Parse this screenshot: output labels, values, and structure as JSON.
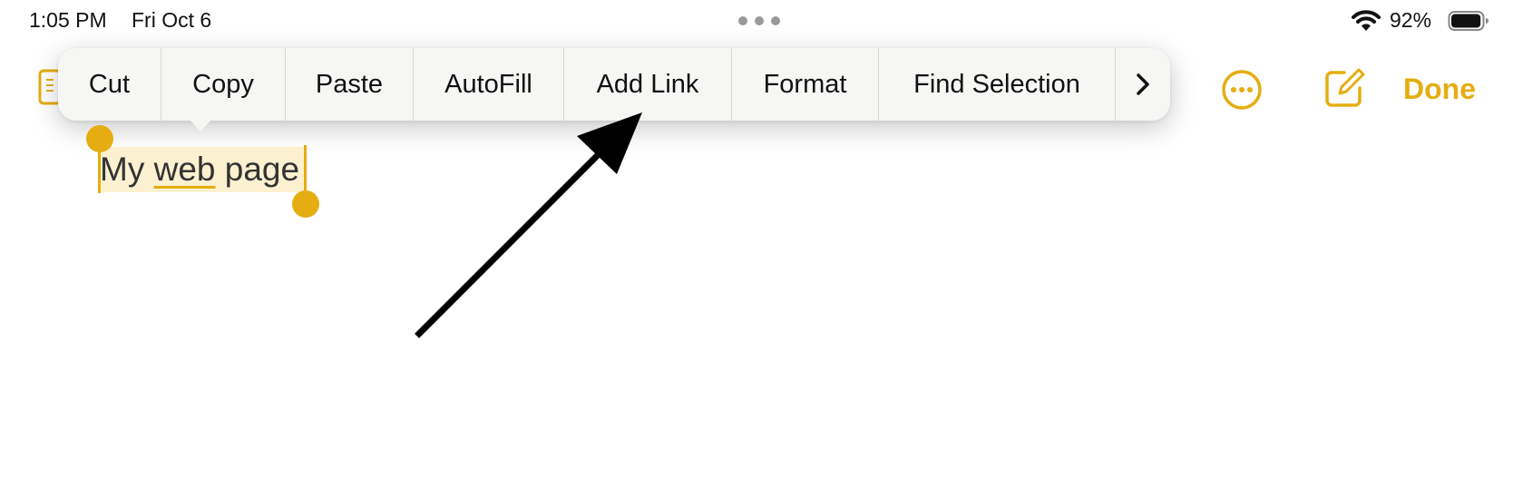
{
  "status_bar": {
    "time": "1:05 PM",
    "date": "Fri Oct 6",
    "battery_percent": "92%",
    "battery_level": 0.92,
    "icons": [
      "multitask-dots-icon",
      "wifi-icon",
      "battery-icon"
    ]
  },
  "toolbar": {
    "icons": [
      "more-icon",
      "compose-icon"
    ],
    "done_label": "Done",
    "accent_color": "#e5ad11"
  },
  "edit_menu": {
    "items": [
      "Cut",
      "Copy",
      "Paste",
      "AutoFill",
      "Add Link",
      "Format",
      "Find Selection"
    ],
    "more_icon": "chevron-right-icon"
  },
  "note": {
    "selected_text": {
      "word1": "My",
      "word2": "web",
      "word3": "page"
    }
  },
  "annotation": {
    "arrow_color": "#000000"
  }
}
